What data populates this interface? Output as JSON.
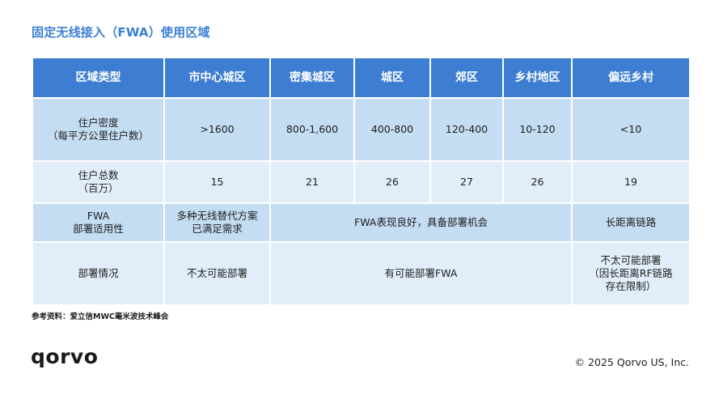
{
  "title": "固定无线接入（FWA）使用区域",
  "header": [
    "区域类型",
    "市中心城区",
    "密集城区",
    "城区",
    "郊区",
    "乡村地区",
    "偏远乡村"
  ],
  "rows": {
    "density": {
      "label_line1": "住户密度",
      "label_line2": "（每平方公里住户数）",
      "values": [
        ">1600",
        "800-1,600",
        "400-800",
        "120-400",
        "10-120",
        "<10"
      ]
    },
    "households": {
      "label_line1": "住户总数",
      "label_line2": "（百万）",
      "values": [
        "15",
        "21",
        "26",
        "27",
        "26",
        "19"
      ]
    },
    "suitability": {
      "label_line1": "FWA",
      "label_line2": "部署适用性",
      "downtown_line1": "多种无线替代方案",
      "downtown_line2": "已满足需求",
      "middle": "FWA表现良好，具备部署机会",
      "remote": "长距离链路"
    },
    "deployment": {
      "label": "部署情况",
      "downtown": "不太可能部署",
      "middle": "有可能部署FWA",
      "remote_line1": "不太可能部署",
      "remote_line2": "（因长距离RF链路",
      "remote_line3": "存在限制）"
    }
  },
  "source_note": "参考资料：爱立信MWC毫米波技术峰会",
  "logo_text": "qorvo",
  "copyright": "© 2025 Qorvo US, Inc.",
  "colors": {
    "title": "#3a7fd5",
    "header_bg": "#3e7ed2",
    "row_dark": "#c4ddf2",
    "row_light": "#e1eef9"
  }
}
